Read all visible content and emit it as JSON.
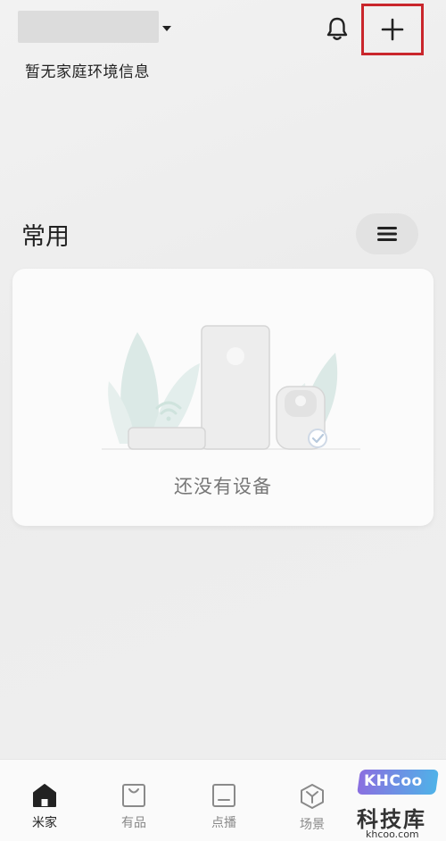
{
  "header": {
    "env_info": "暂无家庭环境信息",
    "bell_icon": "bell-icon",
    "add_icon": "plus-icon",
    "highlight_color": "#c9262c"
  },
  "section": {
    "title": "常用",
    "menu_icon": "hamburger-menu-icon"
  },
  "device_card": {
    "empty_text": "还没有设备"
  },
  "tabbar": {
    "tabs": [
      {
        "label": "米家",
        "icon": "home-icon",
        "active": true
      },
      {
        "label": "有品",
        "icon": "shopping-bag-icon",
        "active": false
      },
      {
        "label": "点播",
        "icon": "media-icon",
        "active": false
      },
      {
        "label": "场景",
        "icon": "scene-cube-icon",
        "active": false
      }
    ]
  },
  "watermark": {
    "logo": "KHCoo",
    "name": "科技库",
    "site": "khcoo.com"
  }
}
